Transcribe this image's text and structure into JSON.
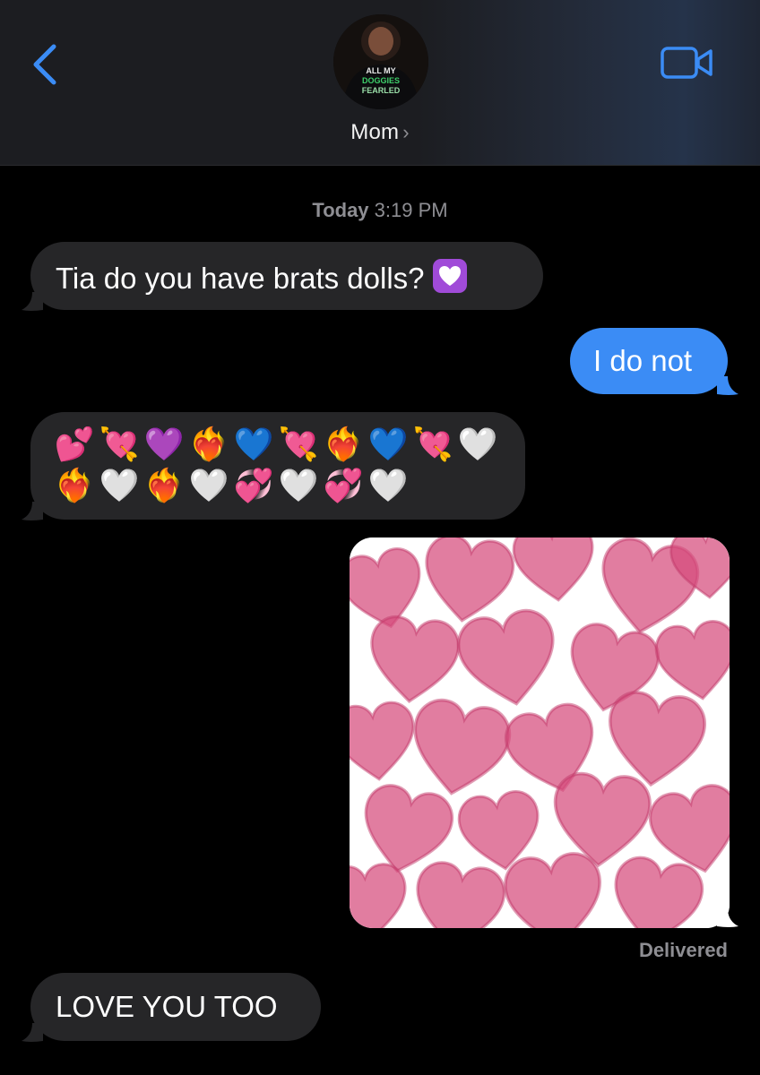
{
  "header": {
    "contact_name": "Mom",
    "name_chevron": "›",
    "avatar_shirt_text": [
      "ALL MY",
      "DOGGIES",
      "FEARLED"
    ],
    "back_icon": "chevron-left-icon",
    "video_icon": "video-camera-icon",
    "accent_color": "#3b8cf5"
  },
  "conversation": {
    "timestamp_day": "Today",
    "timestamp_time": "3:19 PM",
    "messages": [
      {
        "direction": "incoming",
        "text": "Tia do you have brats dolls?",
        "trailing_emoji": "💟"
      },
      {
        "direction": "outgoing",
        "text": "I do not"
      },
      {
        "direction": "incoming",
        "emoji_rows": [
          [
            "💕",
            "💘",
            "💜",
            "❤️‍🔥",
            "💙",
            "💘",
            "❤️‍🔥",
            "💙",
            "💘",
            "🤍"
          ],
          [
            "❤️‍🔥",
            "🤍",
            "❤️‍🔥",
            "🤍",
            "💞",
            "🤍",
            "💞",
            "🤍"
          ]
        ]
      },
      {
        "direction": "outgoing",
        "type": "image",
        "image_description": "pink-hearts-drawing"
      },
      {
        "direction": "incoming",
        "text": "LOVE YOU TOO"
      }
    ],
    "delivered_label": "Delivered"
  },
  "colors": {
    "incoming_bubble": "#262628",
    "outgoing_bubble": "#3b8cf5",
    "heart_pink": "#d94a78"
  }
}
